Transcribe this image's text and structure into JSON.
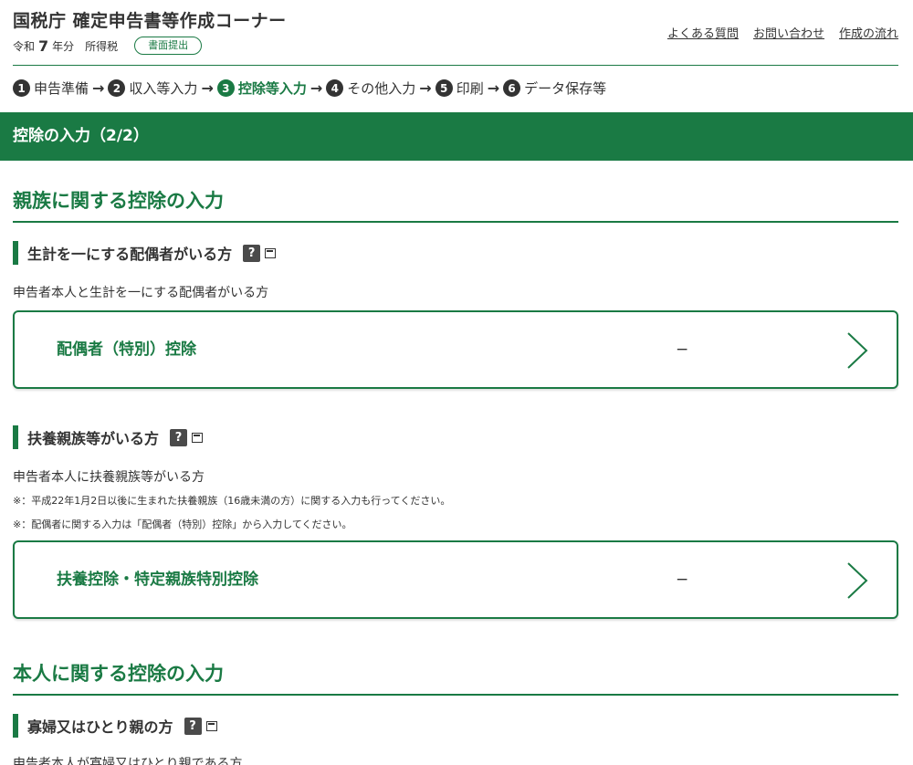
{
  "header": {
    "title": "国税庁 確定申告書等作成コーナー",
    "era": "令和",
    "year": "7",
    "year_suffix": "年分",
    "tax_type": "所得税",
    "badge": "書面提出",
    "links": [
      "よくある質問",
      "お問い合わせ",
      "作成の流れ"
    ]
  },
  "steps": [
    {
      "num": "1",
      "label": "申告準備",
      "current": false
    },
    {
      "num": "2",
      "label": "収入等入力",
      "current": false
    },
    {
      "num": "3",
      "label": "控除等入力",
      "current": true
    },
    {
      "num": "4",
      "label": "その他入力",
      "current": false
    },
    {
      "num": "5",
      "label": "印刷",
      "current": false
    },
    {
      "num": "6",
      "label": "データ保存等",
      "current": false
    }
  ],
  "banner": "控除の入力（2/2）",
  "sections": {
    "family": {
      "title": "親族に関する控除の入力",
      "spouse": {
        "heading": "生計を一にする配偶者がいる方",
        "desc": "申告者本人と生計を一にする配偶者がいる方",
        "card_label": "配偶者（特別）控除",
        "card_value": "−"
      },
      "dependent": {
        "heading": "扶養親族等がいる方",
        "desc": "申告者本人に扶養親族等がいる方",
        "note1": "※：平成22年1月2日以後に生まれた扶養親族（16歳未満の方）に関する入力も行ってください。",
        "note2": "※：配偶者に関する入力は「配偶者（特別）控除」から入力してください。",
        "card_label": "扶養控除・特定親族特別控除",
        "card_value": "−"
      }
    },
    "self": {
      "title": "本人に関する控除の入力",
      "widow": {
        "heading": "寡婦又はひとり親の方",
        "desc": "申告者本人が寡婦又はひとり親である方"
      }
    }
  },
  "icons": {
    "help": "?",
    "help_icon": "question-icon",
    "window_icon": "new-window-icon",
    "chevron_icon": "chevron-right-icon"
  },
  "colors": {
    "brand_green": "#1a7a44",
    "text": "#333333"
  }
}
